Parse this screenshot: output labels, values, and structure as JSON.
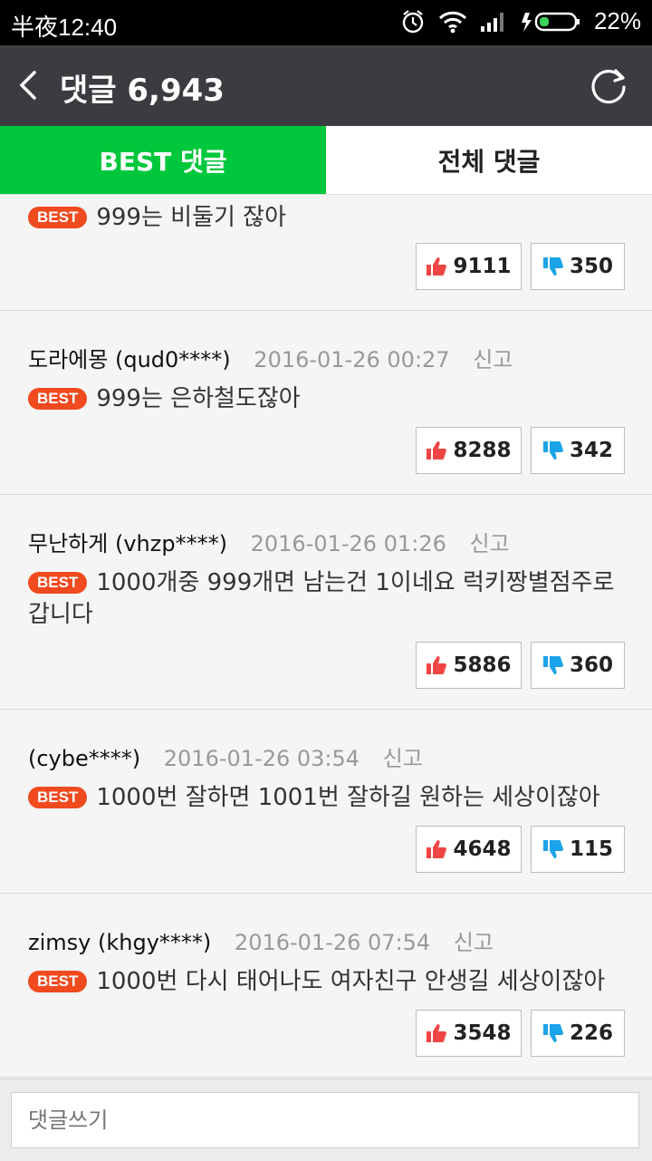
{
  "statusbar": {
    "time": "半夜12:40",
    "battery": "22%"
  },
  "header": {
    "title": "댓글 6,943"
  },
  "tabs": [
    {
      "label": "BEST 댓글"
    },
    {
      "label": "전체 댓글"
    }
  ],
  "badge_label": "BEST",
  "comments": [
    {
      "text": "999는 비둘기 잖아",
      "up": "9111",
      "down": "350"
    },
    {
      "nick": "도라에몽",
      "id": "(qud0****)",
      "date": "2016-01-26 00:27",
      "report": "신고",
      "text": "999는 은하철도잖아",
      "up": "8288",
      "down": "342"
    },
    {
      "nick": "무난하게",
      "id": "(vhzp****)",
      "date": "2016-01-26 01:26",
      "report": "신고",
      "text": "1000개중 999개면 남는건 1이네요 럭키짱별점주로갑니다",
      "up": "5886",
      "down": "360"
    },
    {
      "nick": "",
      "id": "(cybe****)",
      "date": "2016-01-26 03:54",
      "report": "신고",
      "text": "1000번 잘하면 1001번 잘하길 원하는 세상이잖아",
      "up": "4648",
      "down": "115"
    },
    {
      "nick": "zimsy",
      "id": "(khgy****)",
      "date": "2016-01-26 07:54",
      "report": "신고",
      "text": "1000번 다시 태어나도 여자친구 안생길 세상이잖아",
      "up": "3548",
      "down": "226"
    }
  ],
  "input": {
    "placeholder": "댓글쓰기"
  },
  "colors": {
    "accent": "#00c73c",
    "badge": "#f04a1f",
    "like": "#f04545",
    "dislike": "#1aa3e8"
  }
}
